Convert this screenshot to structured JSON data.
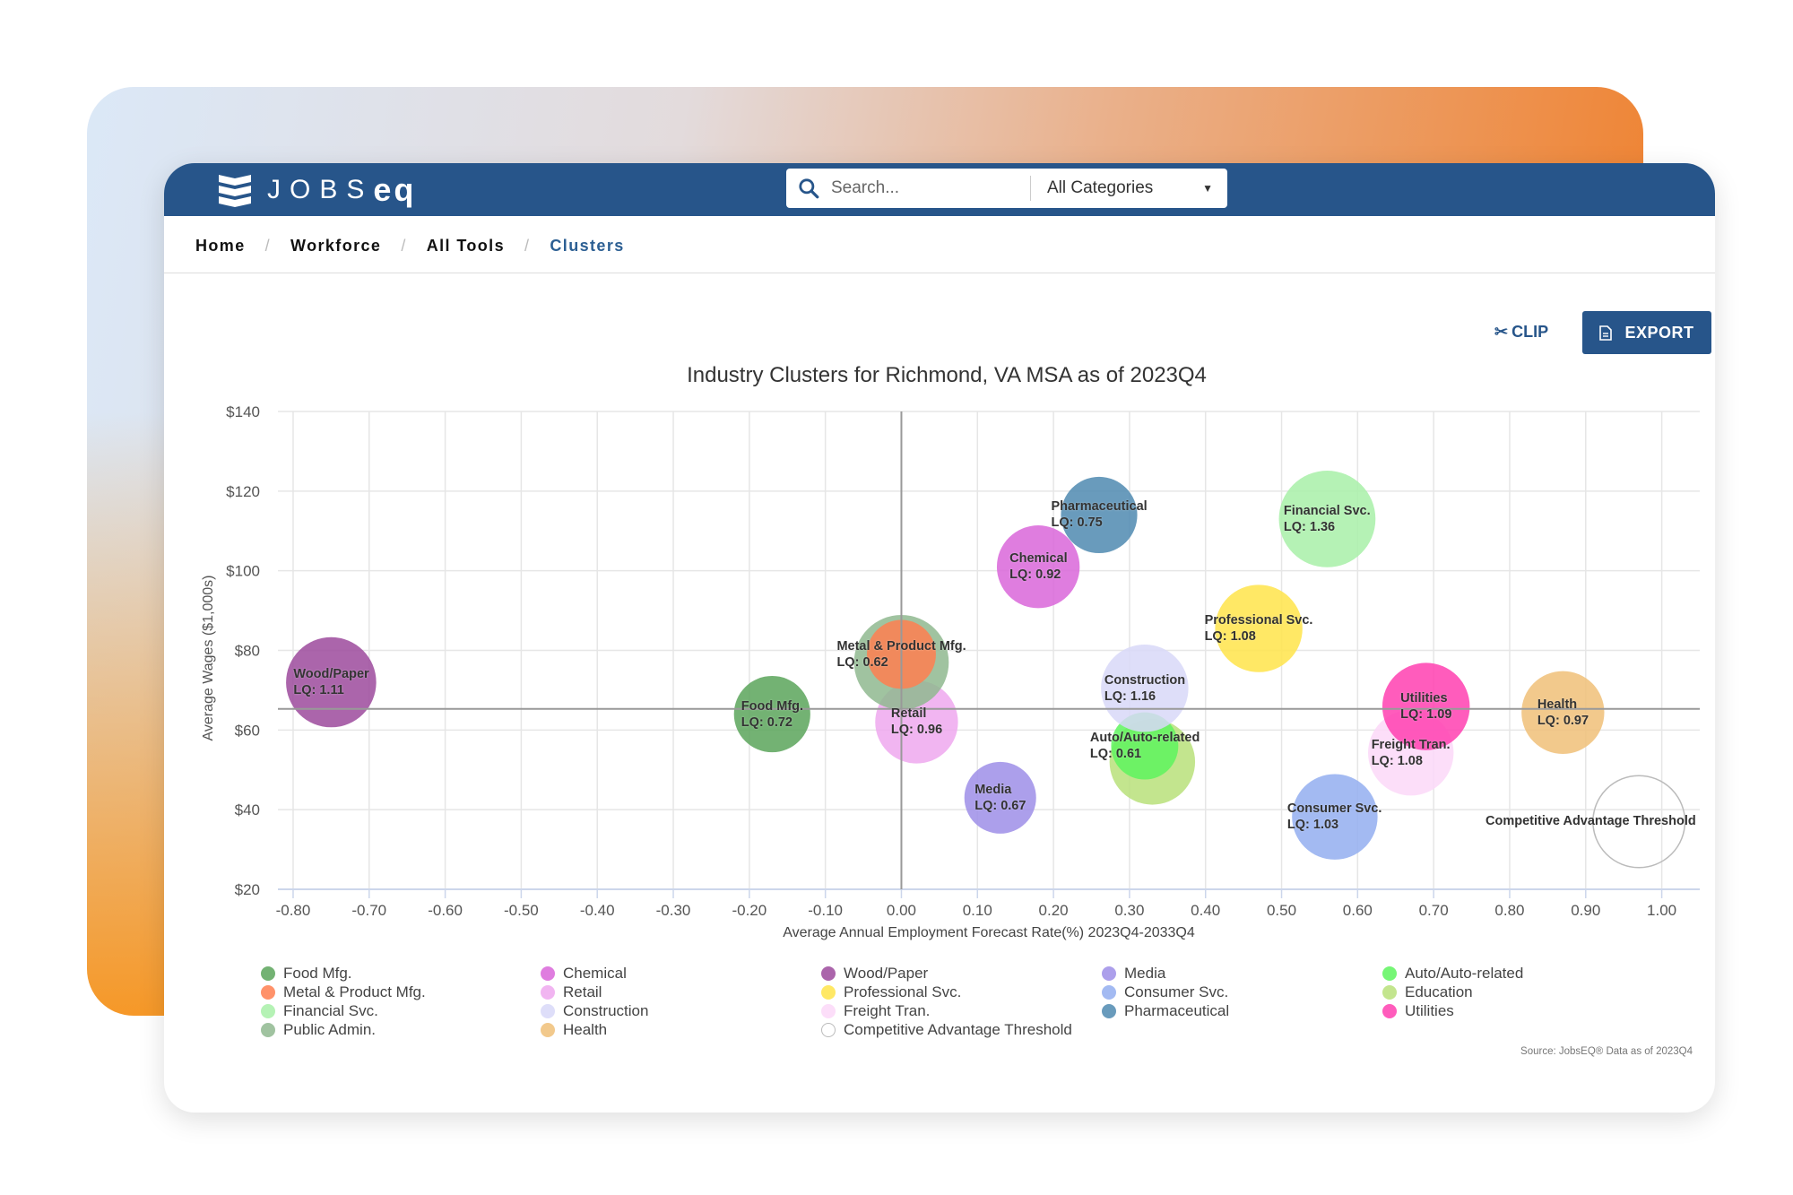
{
  "app": {
    "logo_text_light": "JOBS",
    "logo_text_bold": "eQ"
  },
  "search": {
    "placeholder": "Search...",
    "category": "All Categories"
  },
  "breadcrumb": [
    "Home",
    "Workforce",
    "All Tools",
    "Clusters"
  ],
  "toolbar": {
    "clip_label": "CLIP",
    "export_label": "EXPORT"
  },
  "colors": {
    "header": "#27558a",
    "accent": "#27558a"
  },
  "chart_data": {
    "type": "bubble",
    "title": "Industry Clusters for Richmond, VA MSA as of 2023Q4",
    "xlabel": "Average Annual Employment Forecast Rate(%) 2023Q4-2033Q4",
    "ylabel": "Average Wages ($1,000s)",
    "xlim": [
      -0.82,
      1.05
    ],
    "ylim": [
      20,
      140
    ],
    "x_ticks": [
      "-0.80",
      "-0.70",
      "-0.60",
      "-0.50",
      "-0.40",
      "-0.30",
      "-0.20",
      "-0.10",
      "0.00",
      "0.10",
      "0.20",
      "0.30",
      "0.40",
      "0.50",
      "0.60",
      "0.70",
      "0.80",
      "0.90",
      "1.00"
    ],
    "y_ticks": [
      "$20",
      "$40",
      "$60",
      "$80",
      "$100",
      "$120",
      "$140"
    ],
    "grid": true,
    "reference_lines": {
      "x": 0,
      "y": 65.3
    },
    "legend_position": "bottom",
    "source": "Source: JobsEQ® Data as of 2023Q4",
    "series": [
      {
        "name": "Food Mfg.",
        "color": "#5aa55a",
        "x": -0.17,
        "y": 64,
        "size": 0.83,
        "lq": "LQ: 0.72",
        "label": true
      },
      {
        "name": "Metal & Product Mfg.",
        "color": "#ff7f50",
        "x": 0.0,
        "y": 79,
        "size": 0.75,
        "lq": "LQ: 0.62",
        "label": true
      },
      {
        "name": "Financial Svc.",
        "color": "#a8f0a8",
        "x": 0.56,
        "y": 113,
        "size": 1.05,
        "lq": "LQ: 1.36",
        "label": true
      },
      {
        "name": "Public Admin.",
        "color": "#8fb88f",
        "x": 0.0,
        "y": 77,
        "size": 1.03,
        "lq": "",
        "label": false
      },
      {
        "name": "Chemical",
        "color": "#d966d9",
        "x": 0.18,
        "y": 101,
        "size": 0.9,
        "lq": "LQ: 0.92",
        "label": true
      },
      {
        "name": "Retail",
        "color": "#eea8ee",
        "x": 0.02,
        "y": 62,
        "size": 0.9,
        "lq": "LQ: 0.96",
        "label": true
      },
      {
        "name": "Construction",
        "color": "#d8d8f8",
        "x": 0.32,
        "y": 70.5,
        "size": 0.95,
        "lq": "LQ: 1.16",
        "label": true
      },
      {
        "name": "Health",
        "color": "#f0c078",
        "x": 0.87,
        "y": 64.4,
        "size": 0.9,
        "lq": "LQ: 0.97",
        "label": true
      },
      {
        "name": "Wood/Paper",
        "color": "#9c4a9c",
        "x": -0.75,
        "y": 72,
        "size": 0.98,
        "lq": "LQ: 1.11",
        "label": true
      },
      {
        "name": "Professional Svc.",
        "color": "#ffe44a",
        "x": 0.47,
        "y": 85.5,
        "size": 0.95,
        "lq": "LQ: 1.08",
        "label": true
      },
      {
        "name": "Freight Tran.",
        "color": "#fcd8f8",
        "x": 0.67,
        "y": 54.3,
        "size": 0.93,
        "lq": "LQ: 1.08",
        "label": true
      },
      {
        "name": "Competitive Advantage Threshold",
        "color": "#ffffff",
        "x": 0.97,
        "y": 37,
        "size": 1.0,
        "lq": "",
        "label": true
      },
      {
        "name": "Media",
        "color": "#9d8ee8",
        "x": 0.13,
        "y": 43,
        "size": 0.78,
        "lq": "LQ: 0.67",
        "label": true
      },
      {
        "name": "Consumer Svc.",
        "color": "#93aef0",
        "x": 0.57,
        "y": 38.2,
        "size": 0.93,
        "lq": "LQ: 1.03",
        "label": true
      },
      {
        "name": "Pharmaceutical",
        "color": "#4f89b0",
        "x": 0.26,
        "y": 114,
        "size": 0.83,
        "lq": "LQ: 0.75",
        "label": true
      },
      {
        "name": "Auto/Auto-related",
        "color": "#5ef55e",
        "x": 0.32,
        "y": 56,
        "size": 0.73,
        "lq": "LQ: 0.61",
        "label": true
      },
      {
        "name": "Education",
        "color": "#b8e07a",
        "x": 0.33,
        "y": 52,
        "size": 0.93,
        "lq": "",
        "label": false
      },
      {
        "name": "Utilities",
        "color": "#ff3fb0",
        "x": 0.69,
        "y": 65.9,
        "size": 0.95,
        "lq": "LQ: 1.09",
        "label": true
      }
    ]
  }
}
